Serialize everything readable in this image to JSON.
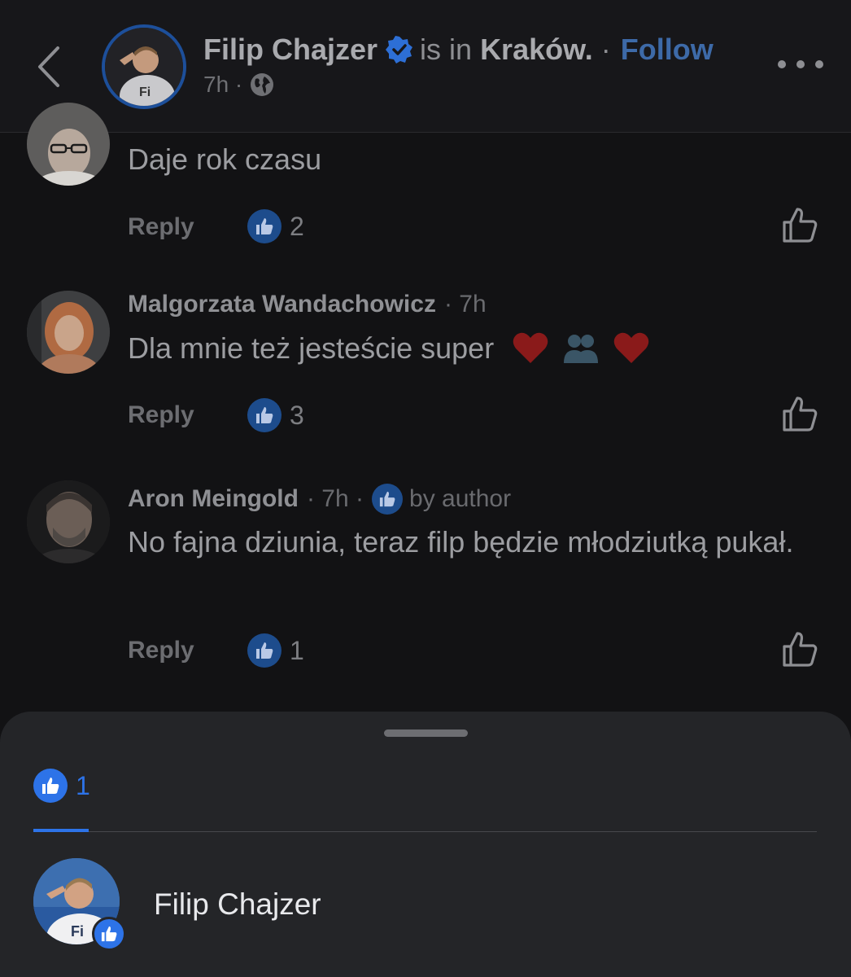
{
  "header": {
    "name": "Filip Chajzer",
    "is_in": "is in",
    "location": "Kraków.",
    "separator": "·",
    "follow": "Follow",
    "time": "7h ·"
  },
  "comments": [
    {
      "name": "",
      "text": "Daje rok czasu",
      "reply": "Reply",
      "likes": "2"
    },
    {
      "name": "Malgorzata Wandachowicz",
      "time": "· 7h",
      "text": "Dla mnie też jesteście super",
      "reply": "Reply",
      "likes": "3"
    },
    {
      "name": "Aron Meingold",
      "time": "· 7h ·",
      "by_author": "by author",
      "text": "No fajna dziunia, teraz filp będzie młodziutką pukał.",
      "reply": "Reply",
      "likes": "1"
    }
  ],
  "sheet": {
    "tab_count": "1",
    "reactor_name": "Filip Chajzer"
  },
  "colors": {
    "accent": "#2d73e8",
    "background": "#121214",
    "sheet": "#242528"
  }
}
